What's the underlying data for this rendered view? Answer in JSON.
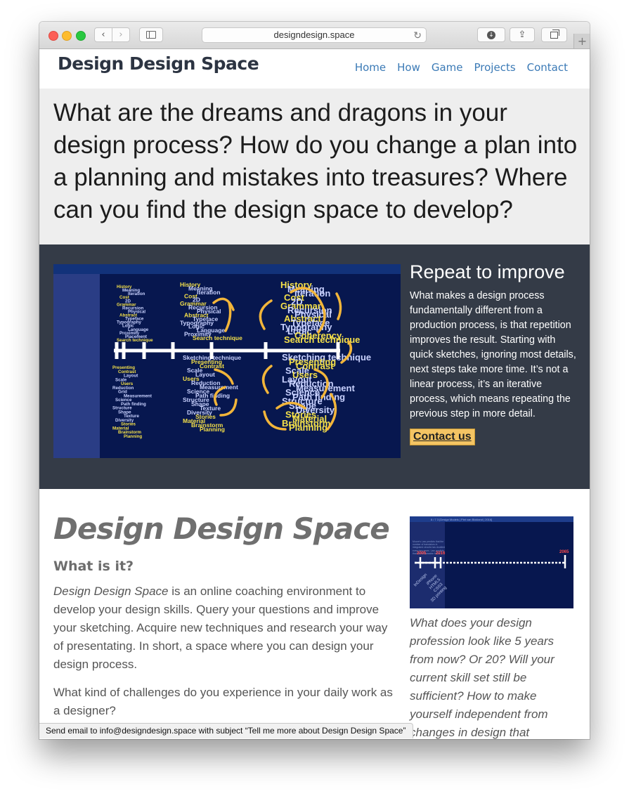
{
  "browser": {
    "url": "designdesign.space",
    "back_glyph": "‹",
    "forward_glyph": "›",
    "share_glyph": "⇪",
    "reload_glyph": "↻",
    "download_glyph": "↓",
    "new_tab_glyph": "+"
  },
  "site": {
    "brand": "Design Design Space",
    "nav": [
      "Home",
      "How",
      "Game",
      "Projects",
      "Contact"
    ]
  },
  "hero": {
    "text": "What are the dreams and dragons in your design process? How do you change a plan into a planning and mistakes into treasures? Where can you find the design space to develop?"
  },
  "repeat": {
    "title": "Repeat to improve",
    "body": "What makes a design process fundamentally different from a production process, is that repetition improves the result. Starting with quick sketches, ignoring most details, next steps take more time. It’s not a linear process, it’s an iterative process, which means repeating the previous step in more detail.",
    "button": "Contact us"
  },
  "figure_words": {
    "col1_top": [
      "History",
      "Meaning",
      "Iteration",
      "Cost",
      "2D",
      "Grammar",
      "Recursion",
      "Physical",
      "Abstract",
      "Typeface",
      "Typography",
      "Logic",
      "Language",
      "Proximity",
      "Placement",
      "Search technique"
    ],
    "col1_bottom": [
      "Presenting",
      "Contrast",
      "Layout",
      "Scale",
      "Users",
      "Reduction",
      "Grid",
      "Measurement",
      "Science",
      "Path finding",
      "Structure",
      "Shape",
      "Texture",
      "Diversity",
      "Stories",
      "Material",
      "Brainstorm",
      "Planning"
    ],
    "col2_top": [
      "History",
      "Meaning",
      "Iteration",
      "Cost",
      "2D",
      "Grammar",
      "Recursion",
      "Physical",
      "Abstract",
      "Typeface",
      "Typography",
      "Logic",
      "Language",
      "Proximity",
      "Search technique"
    ],
    "col2_bottom": [
      "Sketching technique",
      "Presenting",
      "Contrast",
      "Scale",
      "Layout",
      "Users",
      "Reduction",
      "Measurement",
      "Science",
      "Path finding",
      "Structure",
      "Shape",
      "Texture",
      "Diversity",
      "Stories",
      "Material",
      "Brainstorm",
      "Planning"
    ],
    "col3_top": [
      "History",
      "Meaning",
      "Iteration",
      "Cost",
      "2D",
      "Grammar",
      "Recursion",
      "Physical",
      "Abstract",
      "Typeface",
      "Typography",
      "Logic",
      "Coherency",
      "Search technique"
    ],
    "col3_bottom": [
      "Sketching technique",
      "Presenting",
      "Contrast",
      "Scale",
      "Users",
      "Layout",
      "Reduction",
      "Measurement",
      "Science",
      "Path finding",
      "Structure",
      "Shape",
      "Diversity",
      "Stories",
      "Material",
      "Brainstorm",
      "Planning"
    ]
  },
  "content": {
    "title": "Design Design Space",
    "subtitle": "What is it?",
    "para1_em": "Design Design Space",
    "para1_rest": " is an online coaching environment to develop your design skills. Query your questions and improve your sketching. Acquire new techniques and research your way of presentating. In short, a space where you can design your design process.",
    "para2": "What kind of challenges do you experience in your daily work as a designer?",
    "side_caption": "What does your design profession look like 5 years from now? Or 20? Will your current skill set still be sufficient? How to make yourself independent from changes in design that"
  },
  "side_figure": {
    "header": "8 / 7 3  [Design Models | Piet van Blokland | 2016]",
    "years": [
      "2005",
      "2016",
      "2065"
    ],
    "labels": [
      "InDesign",
      "iPhone",
      "HTML5",
      "CSS3",
      "3D printing"
    ],
    "note": "Moore's Law predicts that the number of transistors in integrated circuits has doubled every two years. Law predicts that the foreseeable future"
  },
  "status_bar": "Send email to info@designdesign.space with subject “Tell me more about Design Design Space”",
  "colors": {
    "brand": "#2c3442",
    "nav_link": "#3b7ab6",
    "dark_band": "#343b47",
    "figure_bg": "#07174f",
    "accent_yellow": "#f4c463"
  }
}
